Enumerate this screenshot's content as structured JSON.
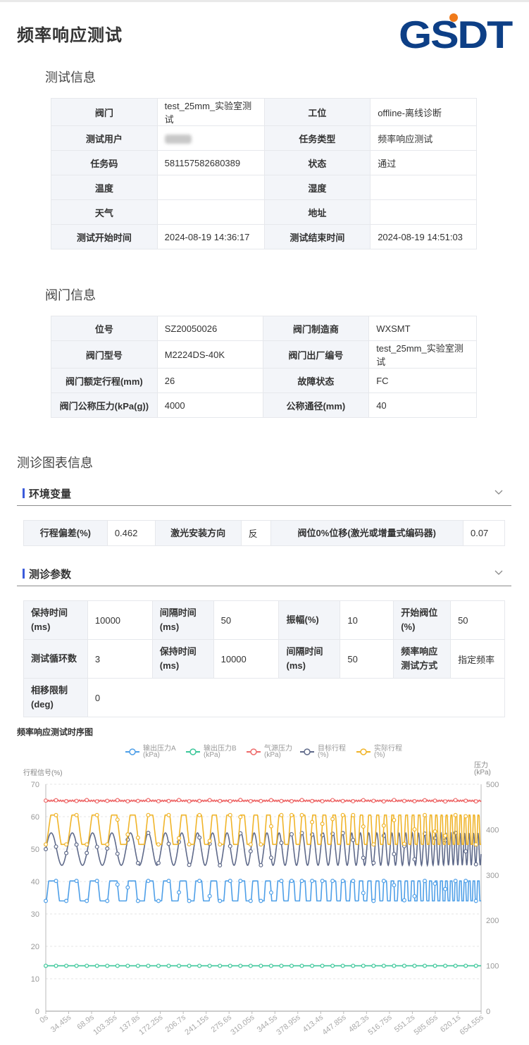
{
  "page": {
    "title": "频率响应测试"
  },
  "logo": {
    "text": "GSDT",
    "color": "#0d3f86",
    "accent": "#f07a1a"
  },
  "test_info": {
    "section_title": "测试信息",
    "rows": [
      [
        {
          "k": "阀门",
          "v": "test_25mm_实验室测试"
        },
        {
          "k": "工位",
          "v": "offline-离线诊断"
        }
      ],
      [
        {
          "k": "测试用户",
          "v": ""
        },
        {
          "k": "任务类型",
          "v": "频率响应测试"
        }
      ],
      [
        {
          "k": "任务码",
          "v": "581157582680389"
        },
        {
          "k": "状态",
          "v": "通过"
        }
      ],
      [
        {
          "k": "温度",
          "v": ""
        },
        {
          "k": "湿度",
          "v": ""
        }
      ],
      [
        {
          "k": "天气",
          "v": ""
        },
        {
          "k": "地址",
          "v": ""
        }
      ],
      [
        {
          "k": "测试开始时间",
          "v": "2024-08-19 14:36:17"
        },
        {
          "k": "测试结束时间",
          "v": "2024-08-19 14:51:03"
        }
      ]
    ]
  },
  "valve_info": {
    "section_title": "阀门信息",
    "rows": [
      [
        {
          "k": "位号",
          "v": "SZ20050026"
        },
        {
          "k": "阀门制造商",
          "v": "WXSMT"
        }
      ],
      [
        {
          "k": "阀门型号",
          "v": "M2224DS-40K"
        },
        {
          "k": "阀门出厂编号",
          "v": "test_25mm_实验室测试"
        }
      ],
      [
        {
          "k": "阀门额定行程(mm)",
          "v": "26"
        },
        {
          "k": "故障状态",
          "v": "FC"
        }
      ],
      [
        {
          "k": "阀门公称压力(kPa(g))",
          "v": "4000"
        },
        {
          "k": "公称通径(mm)",
          "v": "40"
        }
      ]
    ]
  },
  "diag": {
    "section_title": "测诊图表信息",
    "env": {
      "label": "环境变量",
      "cells": [
        {
          "k": "行程偏差(%)",
          "v": "0.462"
        },
        {
          "k": "激光安装方向",
          "v": "反"
        },
        {
          "k": "阀位0%位移(激光或增量式编码器)",
          "v": "0.07"
        }
      ]
    },
    "params": {
      "label": "测诊参数",
      "rows": [
        [
          {
            "k": "保持时间\n(ms)",
            "v": "10000"
          },
          {
            "k": "间隔时间\n(ms)",
            "v": "50"
          },
          {
            "k": "振幅(%)",
            "v": "10"
          },
          {
            "k": "开始阀位\n(%)",
            "v": "50"
          }
        ],
        [
          {
            "k": "测试循环数",
            "v": "3"
          },
          {
            "k": "保持时间\n(ms)",
            "v": "10000"
          },
          {
            "k": "间隔时间\n(ms)",
            "v": "50"
          },
          {
            "k": "频率响应\n测试方式",
            "v": "指定频率"
          }
        ],
        [
          {
            "k": "相移限制\n(deg)",
            "v": "0"
          }
        ]
      ]
    }
  },
  "chart_title": "频率响应测试时序图",
  "chart_data": {
    "type": "line",
    "left_axis": {
      "label": "行程信号(%)",
      "ylim": [
        0,
        70
      ],
      "ticks": [
        0,
        10,
        20,
        30,
        40,
        50,
        60,
        70
      ]
    },
    "right_axis": {
      "label": "压力\n(kPa)",
      "ylim": [
        0,
        500
      ],
      "ticks": [
        0,
        100,
        200,
        300,
        400,
        500
      ]
    },
    "x_ticks": [
      "0s",
      "34.45s",
      "68.9s",
      "103.35s",
      "137.8s",
      "172.25s",
      "206.7s",
      "241.15s",
      "275.6s",
      "310.05s",
      "344.5s",
      "378.95s",
      "413.4s",
      "447.85s",
      "482.3s",
      "516.75s",
      "551.2s",
      "585.65s",
      "620.1s",
      "654.55s"
    ],
    "x_range": [
      0,
      680
    ],
    "legend_position": "top",
    "grid": true,
    "series": [
      {
        "name": "输出压力A\n(kPa)",
        "axis": "right",
        "color": "#4e9fe8",
        "center": 265,
        "amplitude": 22
      },
      {
        "name": "输出压力B\n(kPa)",
        "axis": "right",
        "color": "#3cc79a",
        "center": 100,
        "amplitude": 0
      },
      {
        "name": "气源压力\n(kPa)",
        "axis": "right",
        "color": "#ee6b6b",
        "center": 464,
        "amplitude": 1.5
      },
      {
        "name": "目标行程\n(%)",
        "axis": "left",
        "color": "#5f6a8a",
        "center": 50,
        "amplitude": 5
      },
      {
        "name": "实际行程\n(%)",
        "axis": "left",
        "color": "#f0b429",
        "center": 55.5,
        "amplitude": 5
      }
    ]
  }
}
